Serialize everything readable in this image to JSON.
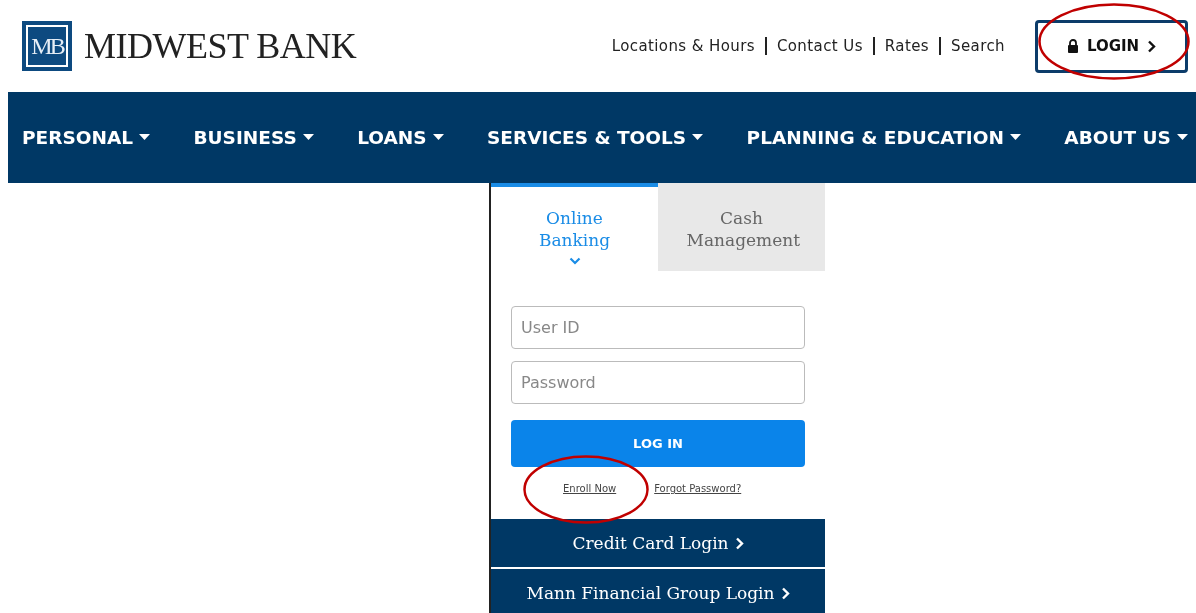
{
  "logo": {
    "monogram": "MB",
    "name": "MIDWEST BANK"
  },
  "utility_links": [
    "Locations & Hours",
    "Contact Us",
    "Rates",
    "Search"
  ],
  "login_button": {
    "label": "LOGIN"
  },
  "nav": [
    {
      "label": "PERSONAL"
    },
    {
      "label": "BUSINESS"
    },
    {
      "label": "LOANS"
    },
    {
      "label": "SERVICES & TOOLS"
    },
    {
      "label": "PLANNING & EDUCATION"
    },
    {
      "label": "ABOUT US"
    }
  ],
  "login_card": {
    "tabs": [
      {
        "label": "Online Banking",
        "selected": true
      },
      {
        "label": "Cash Management",
        "selected": false
      }
    ],
    "fields": [
      {
        "placeholder": "User ID"
      },
      {
        "placeholder": "Password"
      }
    ],
    "submit": "LOG IN",
    "links": [
      "Enroll Now",
      "Forgot Password?"
    ],
    "other_logins": [
      "Credit Card Login",
      "Mann Financial Group Login"
    ]
  },
  "annotations": [
    {
      "kind": "ellipse"
    },
    {
      "kind": "ellipse"
    }
  ]
}
